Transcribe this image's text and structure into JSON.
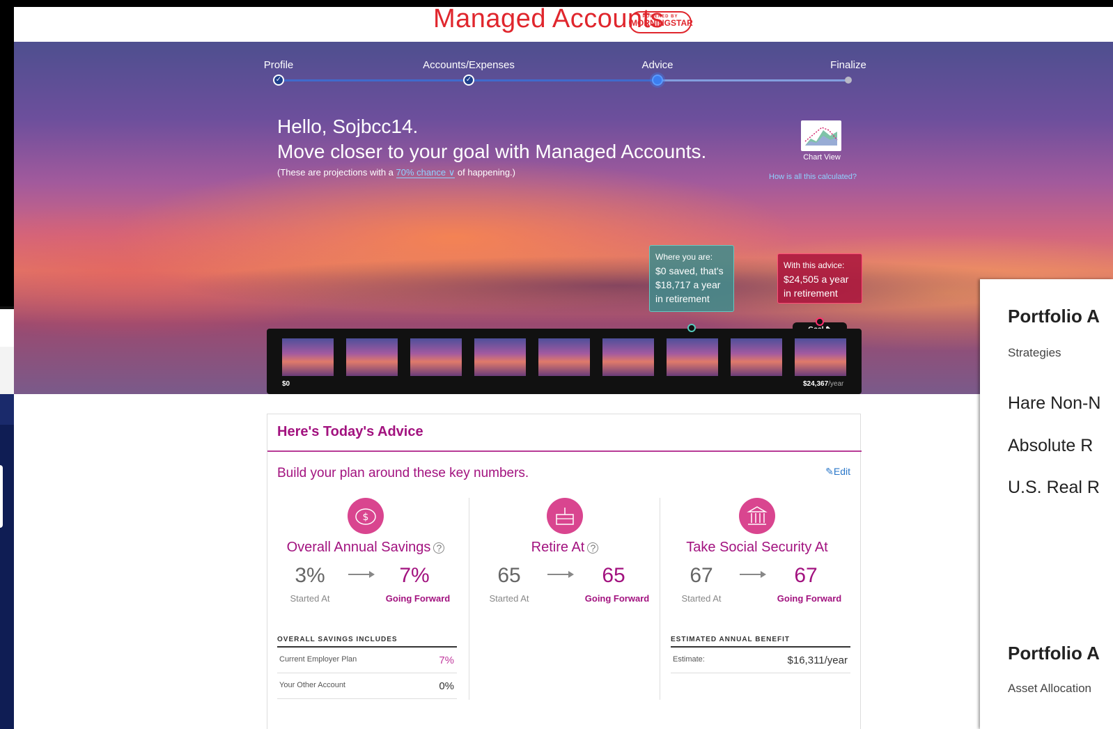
{
  "header": {
    "title": "Managed Accounts",
    "badge_top": "POWERED BY",
    "badge_brand": "MORNINGSTAR"
  },
  "steps": [
    {
      "label": "Profile",
      "state": "done"
    },
    {
      "label": "Accounts/Expenses",
      "state": "done"
    },
    {
      "label": "Advice",
      "state": "current"
    },
    {
      "label": "Finalize",
      "state": "pending"
    }
  ],
  "greeting": {
    "line1": "Hello, Sojbcc14.",
    "line2": "Move closer to your goal with Managed Accounts.",
    "line3_prefix": "(These are projections with a",
    "line3_chance": "70% chance",
    "line3_suffix": "of happening.)"
  },
  "chart_view": {
    "label": "Chart View",
    "how_link": "How is all this calculated?"
  },
  "tooltips": {
    "current": {
      "heading": "Where you are:",
      "text": "$0 saved, that's $18,717 a year in retirement"
    },
    "advice": {
      "heading": "With this advice:",
      "text": "$24,505 a year in retirement"
    }
  },
  "filmstrip": {
    "min_label": "$0",
    "max_value": "$24,367",
    "max_unit": "/year",
    "goal_label": "Goal"
  },
  "advice": {
    "title": "Here's Today's Advice",
    "subtitle": "Build your plan around these key numbers.",
    "edit_label": "Edit",
    "columns": [
      {
        "heading": "Overall Annual Savings",
        "icon": "piggy-bank-icon",
        "start_value": "3%",
        "forward_value": "7%",
        "start_label": "Started At",
        "forward_label": "Going Forward",
        "summary_title": "OVERALL SAVINGS INCLUDES",
        "rows": [
          {
            "label": "Current Employer Plan",
            "value": "7%"
          },
          {
            "label": "Your Other Account",
            "value": "0%"
          }
        ]
      },
      {
        "heading": "Retire At",
        "icon": "birthday-cake-icon",
        "start_value": "65",
        "forward_value": "65",
        "start_label": "Started At",
        "forward_label": "Going Forward"
      },
      {
        "heading": "Take Social Security At",
        "icon": "bank-building-icon",
        "start_value": "67",
        "forward_value": "67",
        "start_label": "Started At",
        "forward_label": "Going Forward",
        "summary_title": "ESTIMATED ANNUAL BENEFIT",
        "rows": [
          {
            "label": "Estimate:",
            "value": "$16,311/year"
          }
        ]
      }
    ]
  },
  "right_panel": {
    "heading1": "Portfolio A",
    "strategies_label": "Strategies",
    "items": [
      "Hare Non-N",
      "Absolute R",
      "U.S. Real R"
    ],
    "heading2": "Portfolio A",
    "asset_label": "Asset Allocation"
  },
  "colors": {
    "brand_red": "#e0262d",
    "accent_magenta": "#a2127f",
    "link_blue": "#2a77c9",
    "step_blue": "#3b6fd6"
  }
}
